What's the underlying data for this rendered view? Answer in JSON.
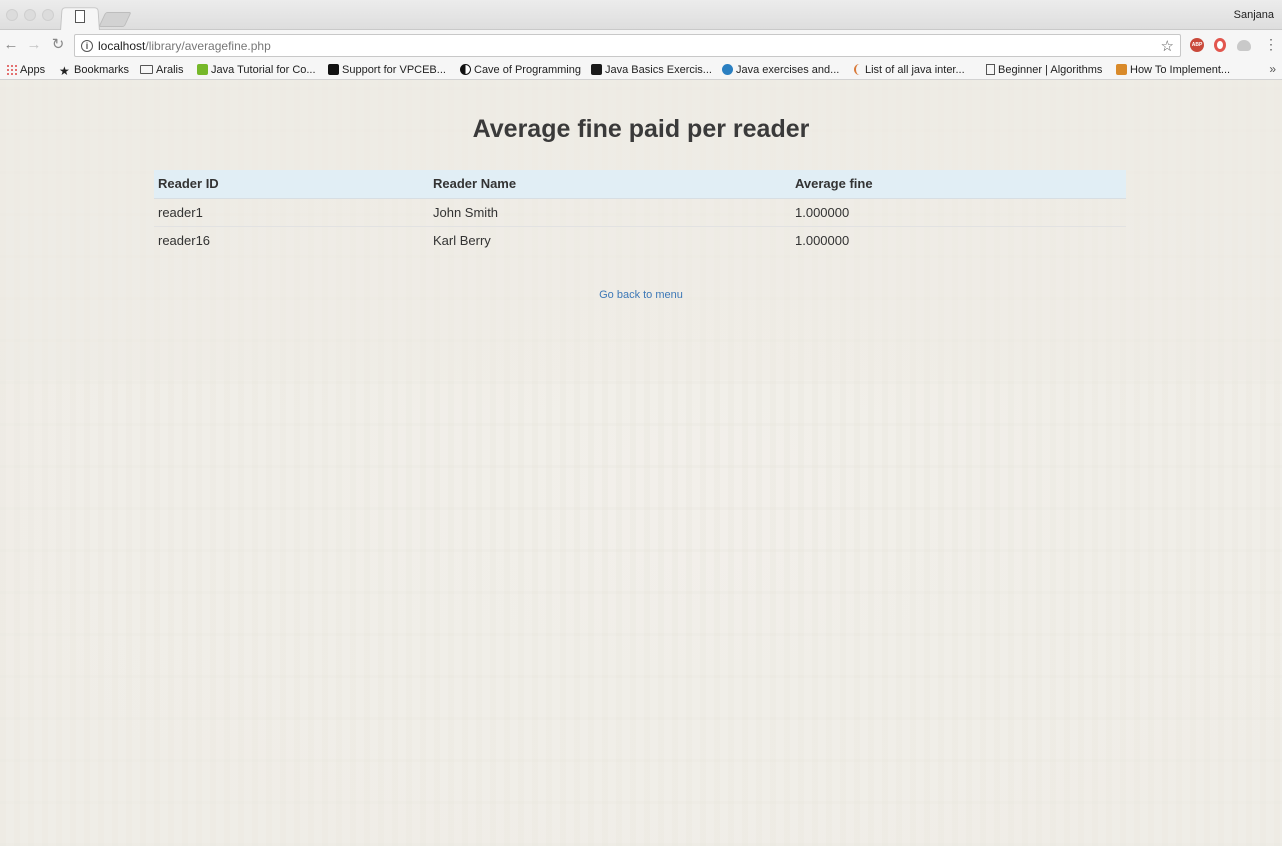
{
  "browser": {
    "profile": "Sanjana",
    "url_host": "localhost",
    "url_path": "/library/averagefine.php",
    "bookmarks": [
      {
        "label": "Apps",
        "icon": "apps-grid-icon"
      },
      {
        "label": "Bookmarks",
        "icon": "star-icon"
      },
      {
        "label": "Aralis",
        "icon": "folder-icon"
      },
      {
        "label": "Java Tutorial for Co...",
        "icon": "udemy-icon"
      },
      {
        "label": "Support for VPCEB...",
        "icon": "sony-s-icon"
      },
      {
        "label": "Cave of Programming",
        "icon": "yin-yang-icon"
      },
      {
        "label": "Java Basics Exercis...",
        "icon": "terminal-icon"
      },
      {
        "label": "Java exercises and...",
        "icon": "java-globe-icon"
      },
      {
        "label": "List of all java inter...",
        "icon": "quote-icon"
      },
      {
        "label": "Beginner | Algorithms",
        "icon": "page-icon"
      },
      {
        "label": "How To Implement...",
        "icon": "orange-square-icon"
      }
    ]
  },
  "page": {
    "title": "Average fine paid per reader",
    "table": {
      "headers": [
        "Reader ID",
        "Reader Name",
        "Average fine"
      ],
      "rows": [
        [
          "reader1",
          "John Smith",
          "1.000000"
        ],
        [
          "reader16",
          "Karl Berry",
          "1.000000"
        ]
      ]
    },
    "back_link": "Go back to menu"
  },
  "colors": {
    "header_row_bg": "#e1eef5",
    "link": "#3d78b6"
  }
}
